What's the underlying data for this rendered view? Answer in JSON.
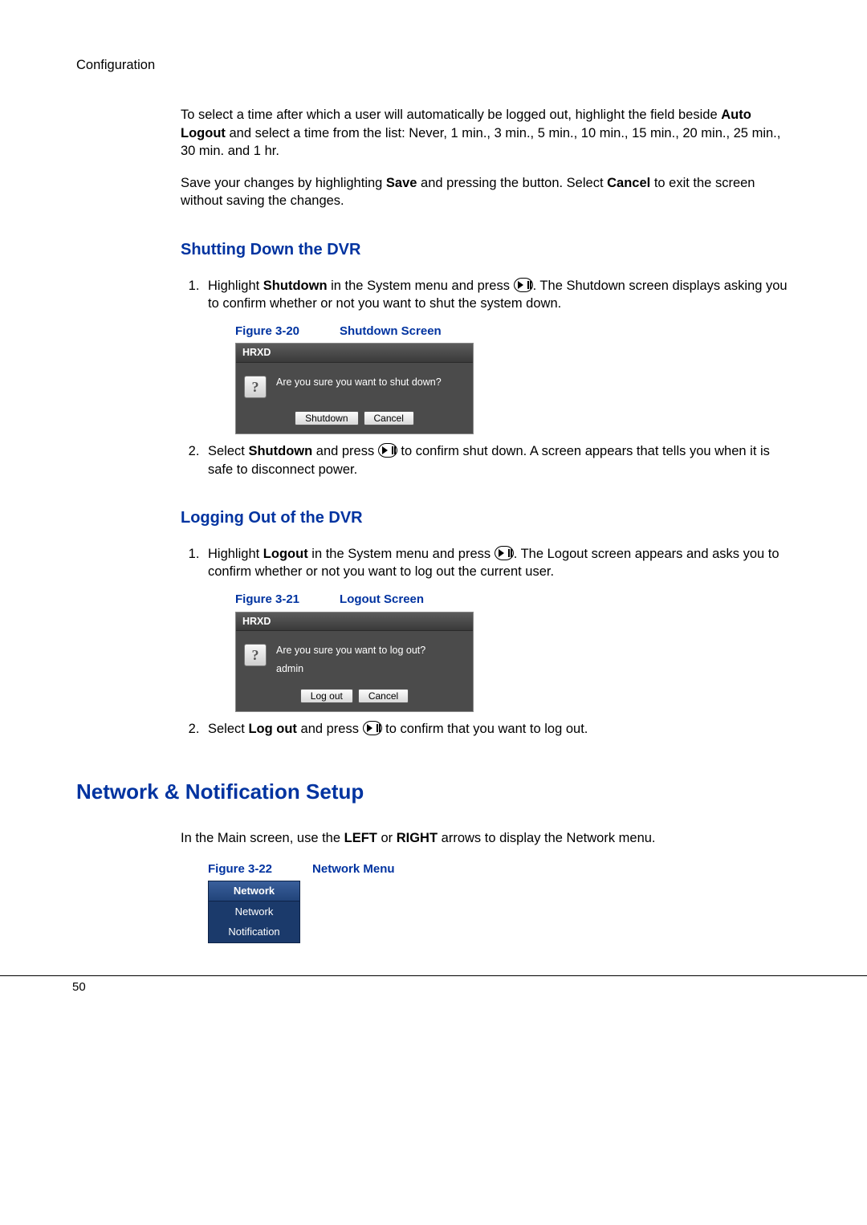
{
  "header": {
    "section": "Configuration"
  },
  "intro": {
    "para1_pre": "To select a time after which a user will automatically be logged out, highlight the field beside ",
    "auto_logout": "Auto Logout",
    "para1_post": " and select a time from the list: Never, 1 min., 3 min., 5 min., 10 min., 15 min., 20 min., 25 min., 30 min. and 1 hr.",
    "para2_pre": "Save your changes by highlighting ",
    "save": "Save",
    "para2_mid": " and pressing the button. Select ",
    "cancel": "Cancel",
    "para2_post": " to exit the screen without saving the changes."
  },
  "shutdown": {
    "heading": "Shutting Down the DVR",
    "step1_pre": "Highlight ",
    "step1_bold": "Shutdown",
    "step1_mid": " in the System menu and press ",
    "step1_post": ". The Shutdown screen displays asking you to confirm whether or not you want to shut the system down.",
    "fig_num": "Figure 3-20",
    "fig_title": "Shutdown Screen",
    "dialog": {
      "title": "HRXD",
      "msg": "Are you sure you want to shut down?",
      "ok": "Shutdown",
      "cancel": "Cancel"
    },
    "step2_pre": "Select ",
    "step2_bold": "Shutdown",
    "step2_mid": " and press ",
    "step2_post": " to confirm shut down. A screen appears that tells you when it is safe to disconnect power."
  },
  "logout": {
    "heading": "Logging Out of the DVR",
    "step1_pre": "Highlight ",
    "step1_bold": "Logout",
    "step1_mid": " in the System menu and press ",
    "step1_post": ". The Logout screen appears and asks you to confirm whether or not you want to log out the current user.",
    "fig_num": "Figure 3-21",
    "fig_title": "Logout Screen",
    "dialog": {
      "title": "HRXD",
      "msg": "Are you sure you want to log out?",
      "sub": "admin",
      "ok": "Log out",
      "cancel": "Cancel"
    },
    "step2_pre": "Select ",
    "step2_bold": "Log out",
    "step2_mid": " and press ",
    "step2_post": " to confirm that you want to log out."
  },
  "network": {
    "heading": "Network & Notification Setup",
    "para_pre": "In the Main screen, use the ",
    "left": "LEFT",
    "or": " or ",
    "right": "RIGHT",
    "para_post": " arrows to display the Network menu.",
    "fig_num": "Figure 3-22",
    "fig_title": "Network Menu",
    "menu": {
      "header": "Network",
      "item1": "Network",
      "item2": "Notification"
    }
  },
  "footer": {
    "page": "50"
  }
}
